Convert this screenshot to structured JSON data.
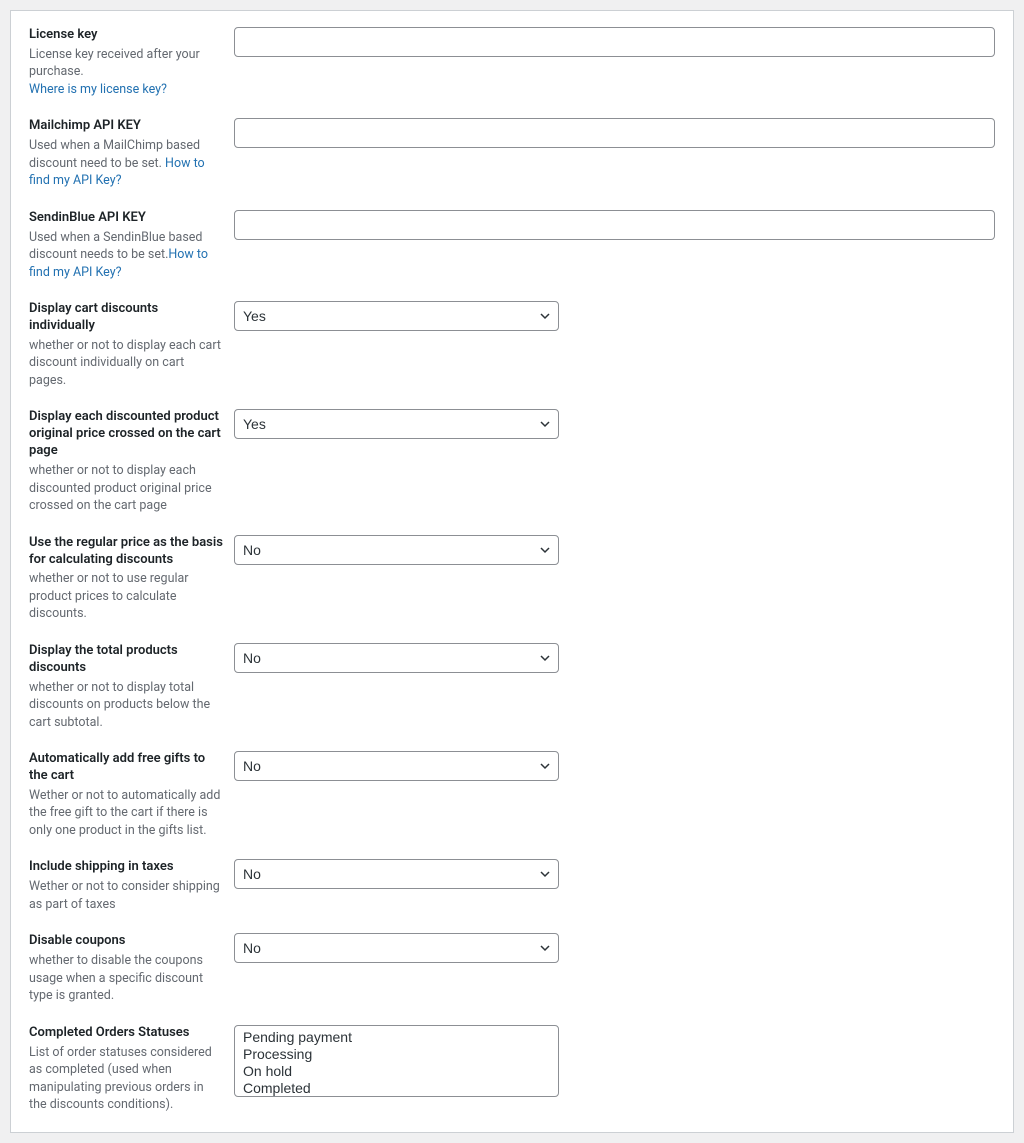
{
  "fields": {
    "license_key": {
      "label": "License key",
      "desc": "License key received after your purchase. ",
      "link": "Where is my license key?",
      "value": ""
    },
    "mailchimp_api": {
      "label": "Mailchimp API KEY",
      "desc": "Used when a MailChimp based discount need to be set. ",
      "link": "How to find my API Key?",
      "value": ""
    },
    "sendinblue_api": {
      "label": "SendinBlue API KEY",
      "desc": "Used when a SendinBlue based discount needs to be set.",
      "link": "How to find my API Key?",
      "value": ""
    },
    "display_cart_discounts": {
      "label": "Display cart discounts individually",
      "desc": "whether or not to display each cart discount individually on cart pages.",
      "value": "Yes"
    },
    "display_crossed_price": {
      "label": "Display each discounted product original price crossed on the cart page",
      "desc": "whether or not to display each discounted product original price crossed on the cart page",
      "value": "Yes"
    },
    "use_regular_price": {
      "label": "Use the regular price as the basis for calculating discounts",
      "desc": "whether or not to use regular product prices to calculate discounts.",
      "value": "No"
    },
    "display_total_discounts": {
      "label": "Display the total products discounts",
      "desc": "whether or not to display total discounts on products below the cart subtotal.",
      "value": "No"
    },
    "auto_add_gifts": {
      "label": "Automatically add free gifts to the cart",
      "desc": "Wether or not to automatically add the free gift to the cart if there is only one product in the gifts list.",
      "value": "No"
    },
    "include_shipping_taxes": {
      "label": "Include shipping in taxes",
      "desc": "Wether or not to consider shipping as part of taxes",
      "value": "No"
    },
    "disable_coupons": {
      "label": "Disable coupons",
      "desc": "whether to disable the coupons usage when a specific discount type is granted.",
      "value": "No"
    },
    "completed_orders_statuses": {
      "label": "Completed Orders Statuses",
      "desc": "List of order statuses considered as completed (used when manipulating previous orders in the discounts conditions).",
      "options": [
        "Pending payment",
        "Processing",
        "On hold",
        "Completed"
      ]
    }
  },
  "select_options": {
    "yes": "Yes",
    "no": "No"
  }
}
